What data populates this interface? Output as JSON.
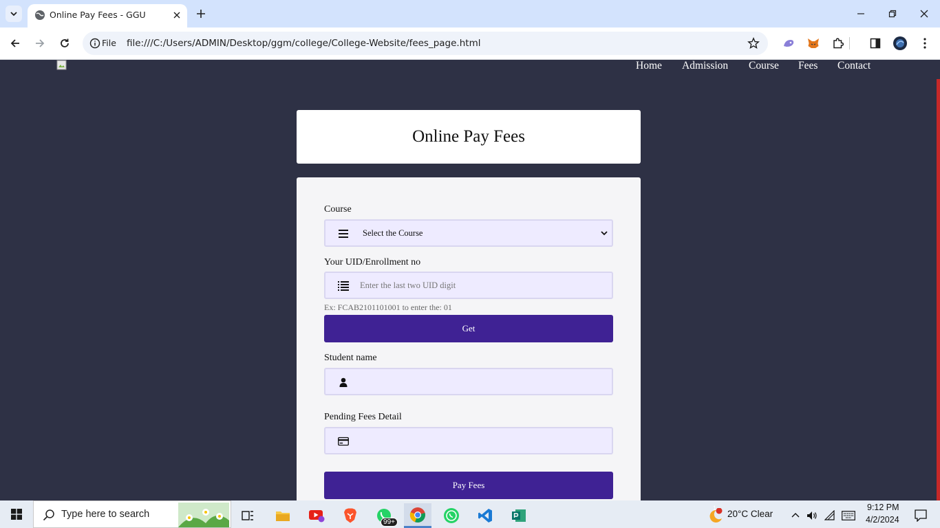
{
  "browser": {
    "tab_title": "Online Pay Fees - GGU",
    "omnibox_scheme": "File",
    "url": "file:///C:/Users/ADMIN/Desktop/ggm/college/College-Website/fees_page.html"
  },
  "nav": {
    "items": [
      "Home",
      "Admission",
      "Course",
      "Fees",
      "Contact"
    ]
  },
  "page": {
    "title": "Online Pay Fees"
  },
  "form": {
    "course_label": "Course",
    "course_selected": "Select the Course",
    "uid_label": "Your UID/Enrollment no",
    "uid_placeholder": "Enter the last two UID digit",
    "uid_hint": "Ex: FCAB2101101001 to enter the: 01",
    "get_button": "Get",
    "student_label": "Student name",
    "student_value": "",
    "pending_label": "Pending Fees Detail",
    "pending_value": "",
    "pay_button": "Pay Fees"
  },
  "taskbar": {
    "search_placeholder": "Type here to search",
    "whatsapp_badge": "99+",
    "weather_badge": "1",
    "weather": "20°C  Clear",
    "time": "9:12 PM",
    "date": "4/2/2024"
  },
  "colors": {
    "page_bg": "#2e3145",
    "button": "#3f2294",
    "field_bg": "#eeebff",
    "scroll_thumb": "#c62828"
  }
}
